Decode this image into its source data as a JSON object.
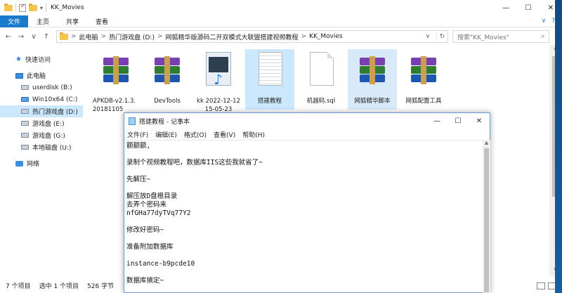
{
  "window": {
    "title": "KK_Movies",
    "controls": {
      "minimize": "—",
      "maximize": "☐",
      "close": "✕"
    }
  },
  "ribbon": {
    "file": "文件",
    "tabs": [
      "主页",
      "共享",
      "查看"
    ],
    "expand": "∨",
    "help": "?"
  },
  "nav": {
    "back": "←",
    "forward": "→",
    "recent": "∨",
    "up": "↑"
  },
  "address": {
    "crumbs": [
      "此电脑",
      "热门游戏盘 (D:)",
      "网狐精华版源码二开双模式大联盟搭建视频教程",
      "KK_Movies"
    ],
    "sep": ">",
    "refresh": "↻",
    "dropdown": "∨"
  },
  "search": {
    "placeholder": "搜索\"KK_Movies\"",
    "icon": "⌕"
  },
  "sidebar": {
    "items": [
      {
        "label": "快速访问",
        "icon": "star-icon"
      },
      {
        "label": "此电脑",
        "icon": "computer-icon"
      },
      {
        "label": "userdisk (B:)",
        "icon": "drive-icon"
      },
      {
        "label": "Win10x64 (C:)",
        "icon": "windows-drive-icon"
      },
      {
        "label": "热门游戏盘 (D:)",
        "icon": "drive-icon"
      },
      {
        "label": "游戏盘 (E:)",
        "icon": "drive-icon"
      },
      {
        "label": "游戏盘 (G:)",
        "icon": "drive-icon"
      },
      {
        "label": "本地磁盘 (U:)",
        "icon": "drive-icon"
      },
      {
        "label": "网络",
        "icon": "network-icon"
      }
    ]
  },
  "files": [
    {
      "name": "APKDB-v2.1.3.20181105",
      "type": "winrar"
    },
    {
      "name": "DevTools",
      "type": "winrar"
    },
    {
      "name": "kk 2022-12-12 15-05-23",
      "type": "video"
    },
    {
      "name": "搭建教程",
      "type": "text"
    },
    {
      "name": "机器码.sql",
      "type": "blank"
    },
    {
      "name": "网狐精华脚本",
      "type": "winrar"
    },
    {
      "name": "网狐配置工具",
      "type": "winrar"
    }
  ],
  "status": {
    "count": "7 个项目",
    "selected": "选中 1 个项目",
    "size": "526 字节"
  },
  "notepad": {
    "title": "搭建教程 - 记事本",
    "menu": [
      "文件(F)",
      "编辑(E)",
      "格式(O)",
      "查看(V)",
      "帮助(H)"
    ],
    "controls": {
      "minimize": "—",
      "maximize": "☐",
      "close": "✕"
    },
    "content": "额额额,\n\n录制个视频教程吧，数据库IIS这些我就省了~\n\n先解压~\n\n解压放D盘根目录\n去弄个密码来\nnfGHa77dyTVq77Y2\n\n修改好密码~\n\n准备附加数据库\n\ninstance-b9pcde10\n\n数据库搞定~\n\n================================\n服务端"
  }
}
